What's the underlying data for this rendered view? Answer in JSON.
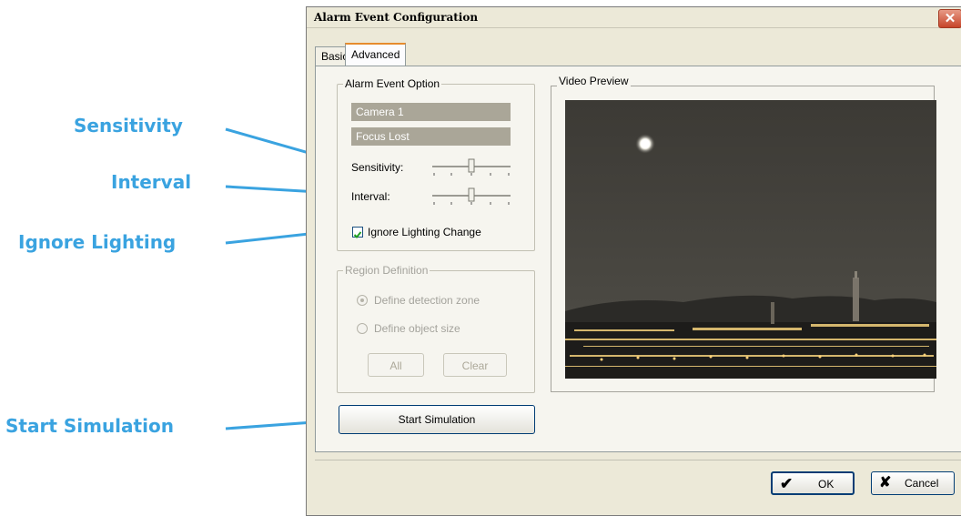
{
  "callouts": {
    "sensitivity": "Sensitivity",
    "interval": "Interval",
    "ignore_lighting": "Ignore Lighting",
    "start_simulation": "Start Simulation"
  },
  "dialog": {
    "title": "Alarm Event Configuration",
    "close_glyph": "✕",
    "tabs": [
      {
        "label": "Basic",
        "selected": false
      },
      {
        "label": "Advanced",
        "selected": true
      }
    ],
    "alarm_event_option": {
      "title": "Alarm Event Option",
      "camera": "Camera 1",
      "event": "Focus Lost",
      "sensitivity_label": "Sensitivity:",
      "sensitivity_level": 0.5,
      "interval_label": "Interval:",
      "interval_level": 0.5,
      "ignore_lighting_label": "Ignore Lighting Change",
      "ignore_lighting_checked": true
    },
    "region_definition": {
      "title": "Region Definition",
      "option_zone": "Define detection zone",
      "option_size": "Define object size",
      "selected": "Define detection zone",
      "all_label": "All",
      "clear_label": "Clear"
    },
    "video_preview_title": "Video Preview",
    "start_simulation_label": "Start Simulation",
    "ok_label": "OK",
    "cancel_label": "Cancel"
  },
  "colors": {
    "callout": "#3aa3e0",
    "field_bg": "#aaa698",
    "tab_accent": "#e68b2c"
  },
  "icons": {
    "close": "close-icon",
    "ok": "checkmark-icon",
    "cancel": "x-icon",
    "checkbox": "checkbox-checked-icon"
  }
}
